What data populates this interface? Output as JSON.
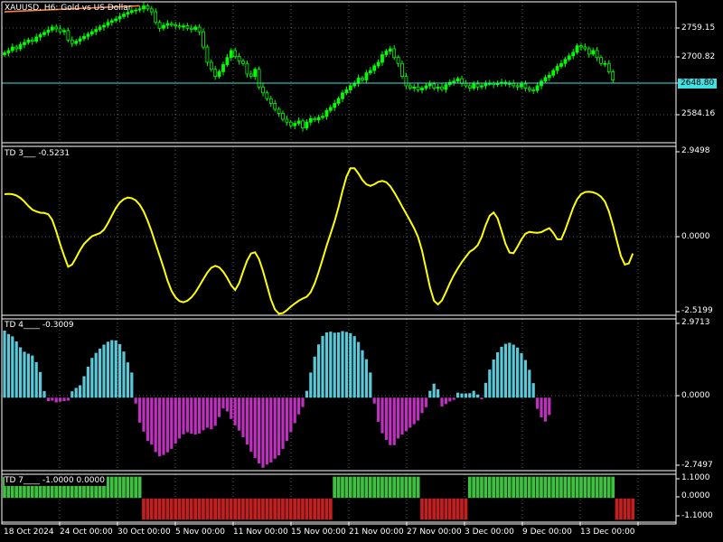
{
  "chart_title": "XAUUSD, H6:  Gold vs US Dollar",
  "colors": {
    "background": "#000000",
    "grid": "#c0c0c0",
    "bull_candle": "#00ff00",
    "bear_candle": "#00ff00",
    "bid_line": "#40e0e0",
    "ma_line": "#ff8040",
    "td3_line": "#ffff00",
    "td4_pos": "#5bc8d8",
    "td4_neg": "#c030c0",
    "td7_pos": "#40c040",
    "td7_neg": "#c02020"
  },
  "main_pane": {
    "price_labels": [
      "2759.15",
      "2700.82",
      "2584.16"
    ],
    "current_price": "2648.80"
  },
  "td3": {
    "label": "TD 3___",
    "value": "-0.5231",
    "scale_labels": [
      "2.9498",
      "0.0000",
      "-2.5199"
    ]
  },
  "td4": {
    "label": "TD 4____",
    "value": "-0.3009",
    "scale_labels": [
      "2.9713",
      "0.0000",
      "-2.7497"
    ]
  },
  "td7": {
    "label": "TD 7____",
    "value": "-1.0000 0.0000",
    "scale_labels": [
      "1.1000",
      "0.0000",
      "-1.1000"
    ]
  },
  "time_axis": [
    "18 Oct 2024",
    "24 Oct 00:00",
    "30 Oct 00:00",
    "5 Nov 00:00",
    "11 Nov 00:00",
    "15 Nov 00:00",
    "21 Nov 00:00",
    "27 Nov 00:00",
    "3 Dec 00:00",
    "9 Dec 00:00",
    "13 Dec 00:00"
  ],
  "chart_data": [
    {
      "type": "candlestick",
      "title": "XAUUSD, H6:  Gold vs US Dollar",
      "ylim": [
        2555,
        2795
      ],
      "close": [
        2708,
        2712,
        2718,
        2715,
        2722,
        2726,
        2730,
        2728,
        2735,
        2739,
        2743,
        2747,
        2752,
        2749,
        2744,
        2746,
        2730,
        2724,
        2728,
        2732,
        2736,
        2740,
        2744,
        2748,
        2752,
        2755,
        2760,
        2763,
        2766,
        2770,
        2774,
        2777,
        2780,
        2781,
        2783,
        2788,
        2783,
        2778,
        2760,
        2750,
        2755,
        2758,
        2756,
        2754,
        2752,
        2754,
        2750,
        2748,
        2752,
        2744,
        2718,
        2692,
        2680,
        2668,
        2676,
        2688,
        2700,
        2712,
        2702,
        2694,
        2690,
        2672,
        2668,
        2680,
        2650,
        2640,
        2630,
        2622,
        2612,
        2605,
        2595,
        2590,
        2584,
        2588,
        2592,
        2580,
        2590,
        2596,
        2594,
        2598,
        2600,
        2610,
        2615,
        2622,
        2630,
        2640,
        2645,
        2652,
        2656,
        2665,
        2662,
        2674,
        2678,
        2686,
        2692,
        2705,
        2711,
        2715,
        2700,
        2690,
        2668,
        2652,
        2648,
        2650,
        2645,
        2648,
        2652,
        2655,
        2648,
        2650,
        2646,
        2654,
        2658,
        2660,
        2664,
        2656,
        2652,
        2648,
        2655,
        2650,
        2652,
        2656,
        2656,
        2654,
        2656,
        2658,
        2655,
        2656,
        2652,
        2650,
        2655,
        2648,
        2645,
        2644,
        2652,
        2660,
        2666,
        2670,
        2678,
        2685,
        2690,
        2697,
        2703,
        2709,
        2720,
        2718,
        2715,
        2706,
        2712,
        2700,
        2690,
        2690,
        2676,
        2662
      ]
    },
    {
      "type": "line",
      "title": "TD 3",
      "ylim": [
        -2.5199,
        2.9498
      ],
      "values": [
        1.4,
        1.41,
        1.4,
        1.36,
        1.28,
        1.16,
        1.02,
        0.9,
        0.84,
        0.8,
        0.79,
        0.75,
        0.57,
        0.2,
        -0.22,
        -0.6,
        -0.95,
        -0.88,
        -0.65,
        -0.41,
        -0.21,
        -0.08,
        0.04,
        0.09,
        0.14,
        0.25,
        0.46,
        0.71,
        0.95,
        1.13,
        1.24,
        1.29,
        1.27,
        1.2,
        1.06,
        0.84,
        0.54,
        0.19,
        -0.21,
        -0.59,
        -0.98,
        -1.4,
        -1.73,
        -1.94,
        -2.06,
        -2.1,
        -2.05,
        -1.94,
        -1.78,
        -1.57,
        -1.35,
        -1.14,
        -0.98,
        -0.92,
        -0.97,
        -1.11,
        -1.31,
        -1.55,
        -1.7,
        -1.48,
        -1.1,
        -0.75,
        -0.52,
        -0.48,
        -0.7,
        -1.09,
        -1.55,
        -2.01,
        -2.33,
        -2.47,
        -2.45,
        -2.36,
        -2.24,
        -2.14,
        -2.05,
        -1.98,
        -1.92,
        -1.77,
        -1.49,
        -1.12,
        -0.7,
        -0.27,
        0.12,
        0.52,
        0.98,
        1.51,
        1.97,
        2.24,
        2.24,
        2.07,
        1.86,
        1.72,
        1.67,
        1.72,
        1.8,
        1.83,
        1.79,
        1.66,
        1.46,
        1.24,
        1.0,
        0.77,
        0.54,
        0.3,
        0.01,
        -0.43,
        -1.02,
        -1.62,
        -2.05,
        -2.17,
        -2.04,
        -1.77,
        -1.48,
        -1.22,
        -1.0,
        -0.8,
        -0.63,
        -0.46,
        -0.38,
        -0.25,
        0.02,
        0.4,
        0.7,
        0.81,
        0.62,
        0.21,
        -0.21,
        -0.49,
        -0.51,
        -0.3,
        -0.06,
        0.12,
        0.18,
        0.16,
        0.15,
        0.17,
        0.24,
        0.3,
        0.15,
        -0.06,
        -0.06,
        0.24,
        0.6,
        0.96,
        1.24,
        1.4,
        1.47,
        1.48,
        1.46,
        1.41,
        1.32,
        1.16,
        0.84,
        0.4,
        -0.11,
        -0.6,
        -0.88,
        -0.84,
        -0.52
      ]
    },
    {
      "type": "histogram",
      "title": "TD 4",
      "ylim": [
        -2.7497,
        2.9713
      ],
      "values": [
        2.53,
        2.4,
        2.31,
        2.12,
        1.9,
        1.73,
        1.66,
        1.59,
        1.34,
        0.97,
        0.25,
        -0.13,
        -0.11,
        -0.18,
        -0.15,
        -0.13,
        -0.11,
        0.24,
        0.37,
        0.47,
        0.81,
        1.17,
        1.5,
        1.69,
        1.85,
        2.0,
        2.11,
        2.17,
        2.16,
        2.02,
        1.74,
        1.33,
        0.95,
        -0.22,
        -0.94,
        -1.28,
        -1.63,
        -1.77,
        -2.05,
        -2.21,
        -2.16,
        -2.06,
        -1.93,
        -1.73,
        -1.54,
        -1.38,
        -1.3,
        -1.36,
        -1.39,
        -1.35,
        -1.23,
        -1.13,
        -1.19,
        -1.06,
        -0.73,
        -0.41,
        -0.52,
        -0.8,
        -1.04,
        -1.24,
        -1.49,
        -1.77,
        -2.03,
        -2.27,
        -2.48,
        -2.64,
        -2.52,
        -2.44,
        -2.3,
        -2.17,
        -1.93,
        -1.63,
        -1.3,
        -0.96,
        -0.63,
        -0.35,
        0.26,
        0.95,
        1.55,
        2.01,
        2.33,
        2.46,
        2.49,
        2.45,
        2.46,
        2.51,
        2.48,
        2.43,
        2.32,
        2.1,
        1.79,
        1.45,
        0.95,
        -0.22,
        -0.91,
        -1.34,
        -1.59,
        -1.79,
        -1.79,
        -1.54,
        -1.39,
        -1.26,
        -1.13,
        -1.0,
        -0.86,
        -0.58,
        -0.36,
        0.26,
        0.53,
        0.32,
        -0.33,
        -0.24,
        -0.14,
        -0.08,
        0.19,
        0.16,
        0.16,
        0.17,
        0.26,
        0.12,
        -0.06,
        0.56,
        1.06,
        1.44,
        1.71,
        1.92,
        2.03,
        2.07,
        2.0,
        1.89,
        1.68,
        1.42,
        1.05,
        0.55,
        -0.42,
        -0.74,
        -0.9,
        -0.65
      ]
    },
    {
      "type": "histogram",
      "title": "TD 7",
      "ylim": [
        -1.1,
        1.1
      ],
      "values": [
        1,
        1,
        1,
        1,
        1,
        1,
        1,
        1,
        1,
        1,
        1,
        1,
        1,
        1,
        1,
        1,
        1,
        1,
        1,
        1,
        1,
        1,
        1,
        1,
        1,
        1,
        1,
        1,
        1,
        1,
        1,
        1,
        1,
        1,
        1,
        -1,
        -1,
        -1,
        -1,
        -1,
        -1,
        -1,
        -1,
        -1,
        -1,
        -1,
        -1,
        -1,
        -1,
        -1,
        -1,
        -1,
        -1,
        -1,
        -1,
        -1,
        -1,
        -1,
        -1,
        -1,
        -1,
        -1,
        -1,
        -1,
        -1,
        -1,
        -1,
        -1,
        -1,
        -1,
        -1,
        -1,
        -1,
        -1,
        -1,
        -1,
        -1,
        -1,
        -1,
        -1,
        -1,
        -1,
        -1,
        1,
        1,
        1,
        1,
        1,
        1,
        1,
        1,
        1,
        1,
        1,
        1,
        1,
        1,
        1,
        1,
        1,
        1,
        1,
        1,
        1,
        1,
        -1,
        -1,
        -1,
        -1,
        -1,
        -1,
        -1,
        -1,
        -1,
        -1,
        -1,
        -1,
        1,
        1,
        1,
        1,
        1,
        1,
        1,
        1,
        1,
        1,
        1,
        1,
        1,
        1,
        1,
        1,
        1,
        1,
        1,
        1,
        1,
        1,
        1,
        1,
        1,
        1,
        1,
        1,
        1,
        1,
        1,
        1,
        1,
        1,
        1,
        1,
        1,
        -1,
        -1,
        -1,
        -1,
        -1
      ]
    }
  ]
}
